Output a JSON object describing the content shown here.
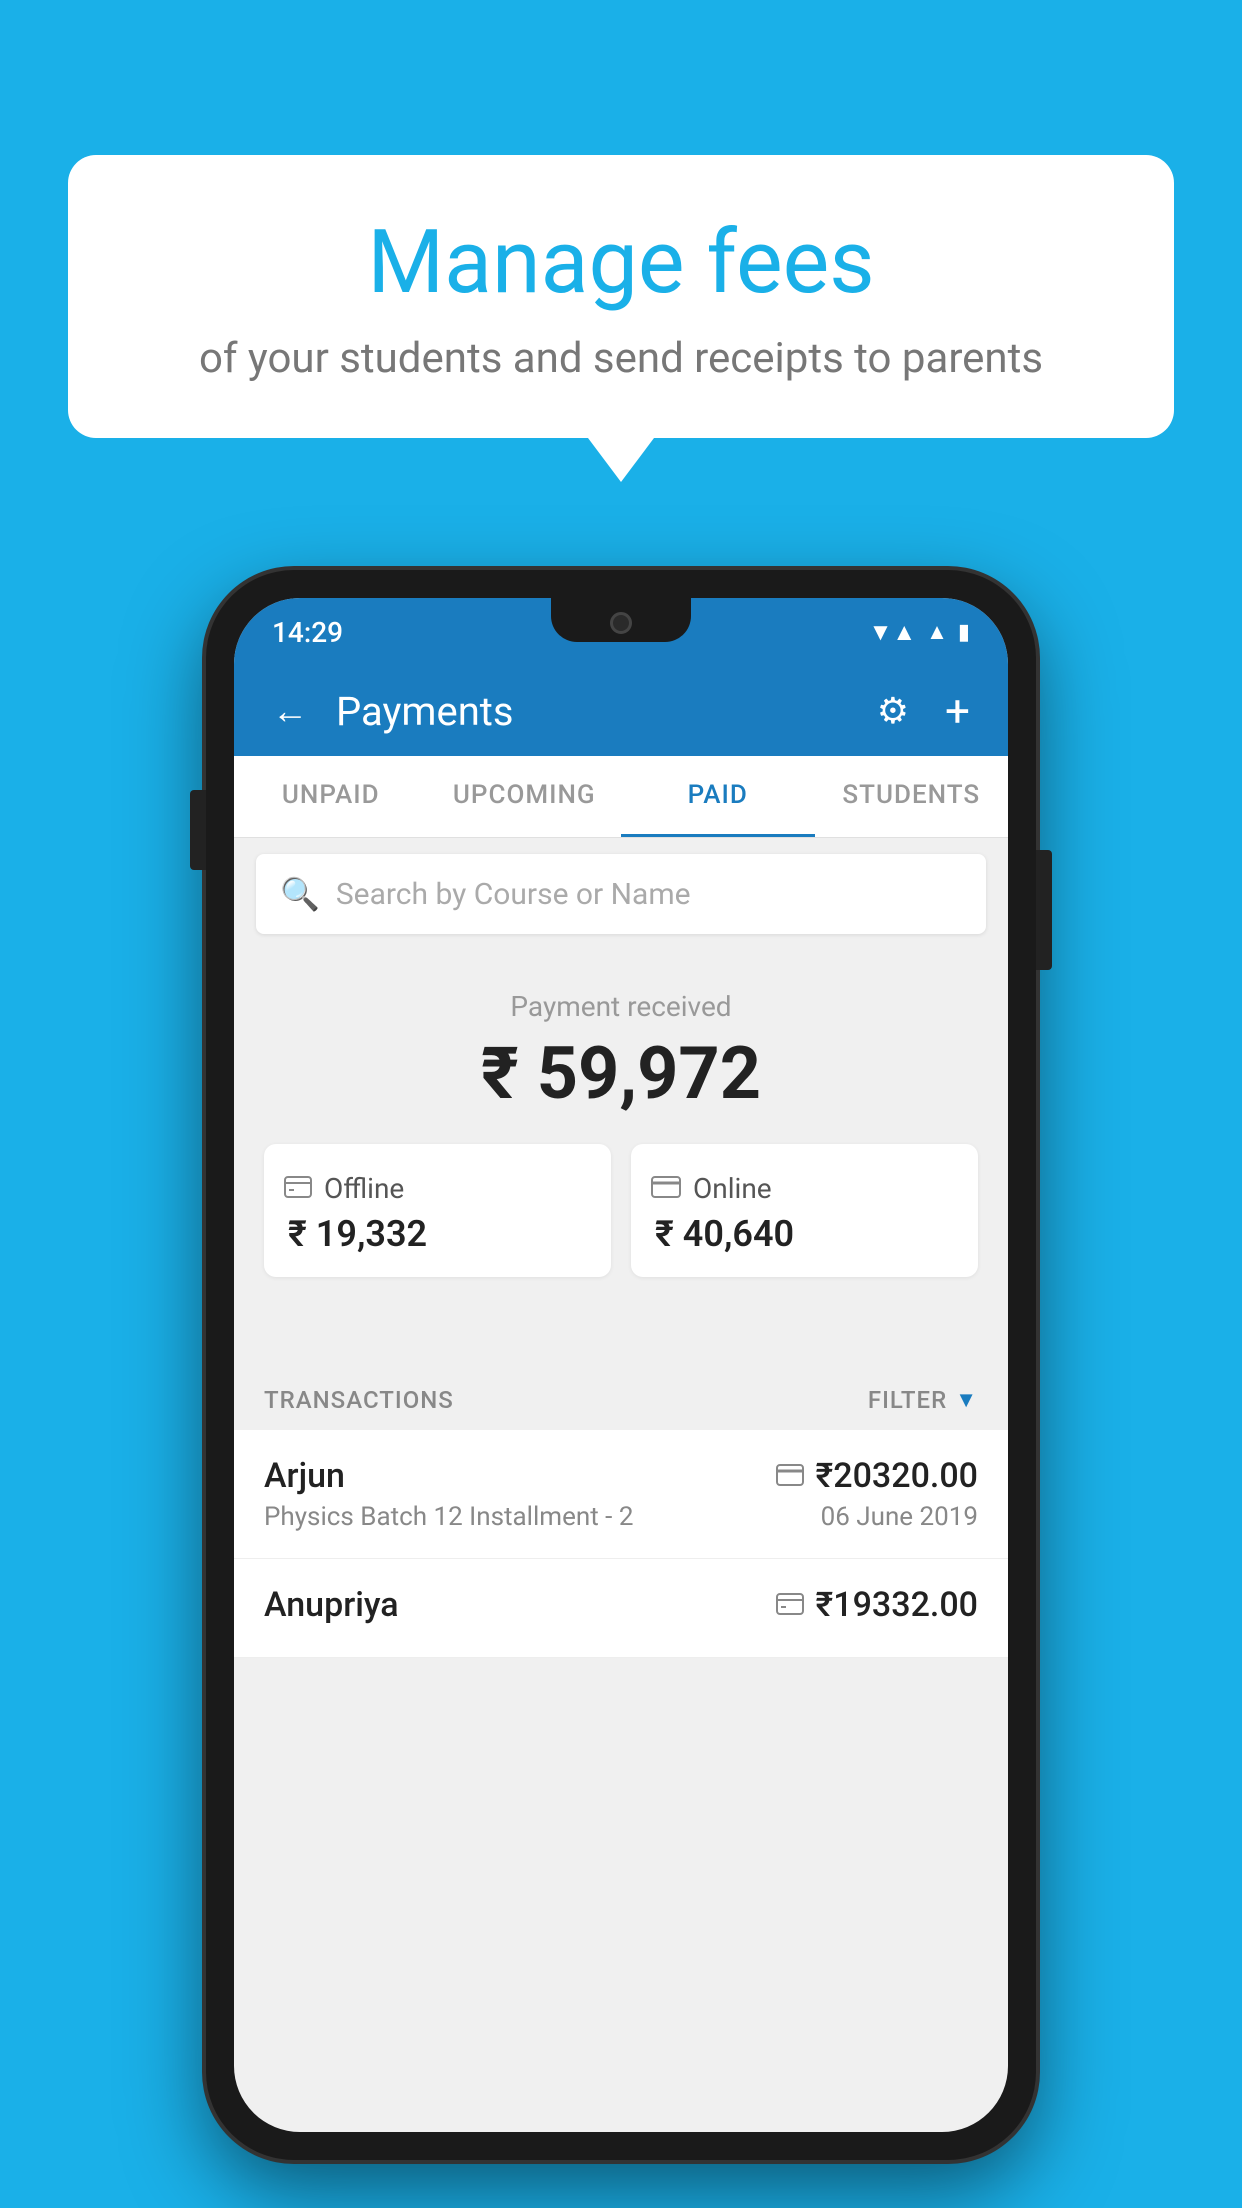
{
  "page": {
    "bg_color": "#1ab0e8"
  },
  "tooltip": {
    "title": "Manage fees",
    "subtitle": "of your students and send receipts to parents"
  },
  "status_bar": {
    "time": "14:29",
    "wifi": "▼▲",
    "signal": "▲",
    "battery": "▮"
  },
  "header": {
    "back_label": "←",
    "title": "Payments",
    "gear_label": "⚙",
    "plus_label": "+"
  },
  "tabs": [
    {
      "id": "unpaid",
      "label": "UNPAID",
      "active": false
    },
    {
      "id": "upcoming",
      "label": "UPCOMING",
      "active": false
    },
    {
      "id": "paid",
      "label": "PAID",
      "active": true
    },
    {
      "id": "students",
      "label": "STUDENTS",
      "active": false
    }
  ],
  "search": {
    "placeholder": "Search by Course or Name"
  },
  "payment_summary": {
    "label": "Payment received",
    "amount": "₹ 59,972",
    "offline": {
      "label": "Offline",
      "amount": "₹ 19,332"
    },
    "online": {
      "label": "Online",
      "amount": "₹ 40,640"
    }
  },
  "transactions_section": {
    "label": "TRANSACTIONS",
    "filter_label": "FILTER"
  },
  "transactions": [
    {
      "name": "Arjun",
      "icon": "card",
      "amount": "₹20320.00",
      "course": "Physics Batch 12 Installment - 2",
      "date": "06 June 2019"
    },
    {
      "name": "Anupriya",
      "icon": "cash",
      "amount": "₹19332.00",
      "course": "",
      "date": ""
    }
  ]
}
